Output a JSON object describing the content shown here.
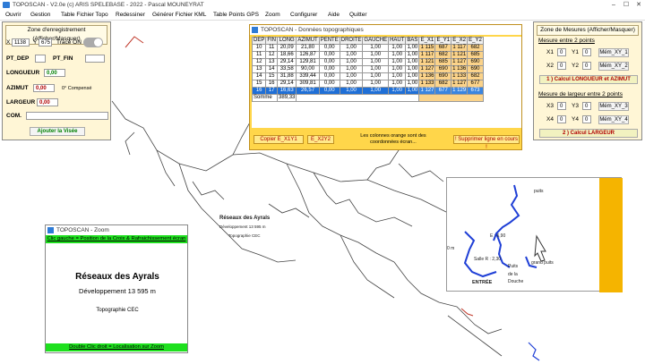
{
  "window": {
    "title": "TOPOSCAN - V2.0e (c) ARIS SPELEBASE - 2022 - Pascal MOUNEYRAT",
    "controls": [
      "–",
      "☐",
      "✕"
    ]
  },
  "menu": [
    "Ouvrir",
    "Gestion",
    "Table Fichier Topo",
    "Redessiner",
    "Générer Fichier KML",
    "Table Points GPS",
    "Zoom",
    "Configurer",
    "Aide",
    "Quitter"
  ],
  "left_panel": {
    "header": "Zone d'enregistrement (Afficher/Masquer)",
    "x_label": "X",
    "x_value": "1138",
    "y_label": "Y",
    "y_value": "675",
    "trace_label": "Tracé ON",
    "pt_dep": "PT_DEP",
    "pt_fin": "PT_FIN",
    "longueur_label": "LONGUEUR",
    "longueur_value": "0,00",
    "azimut_label": "AZIMUT",
    "azimut_value": "0,00",
    "azimut_note": "0° Compensé",
    "largeur_label": "LARGEUR",
    "largeur_value": "0,00",
    "com_label": "COM.",
    "add_button": "Ajouter la Visée"
  },
  "topo_window": {
    "title": "TOPOSCAN - Données topographiques",
    "columns": [
      "DEP",
      "FIN",
      "LONG",
      "AZIMUT",
      "PENTE",
      "DROITE",
      "GAUCHE",
      "HAUT",
      "BAS",
      "E_X1",
      "E_Y1",
      "E_X2",
      "E_Y2"
    ],
    "rows": [
      [
        "10",
        "11",
        "20,09",
        "21,80",
        "0,00",
        "1,00",
        "1,00",
        "1,00",
        "1,00",
        "1 115",
        "687",
        "1 117",
        "682"
      ],
      [
        "11",
        "12",
        "18,66",
        "126,87",
        "0,00",
        "1,00",
        "1,00",
        "1,00",
        "1,00",
        "1 117",
        "682",
        "1 121",
        "685"
      ],
      [
        "12",
        "13",
        "29,14",
        "129,81",
        "0,00",
        "1,00",
        "1,00",
        "1,00",
        "1,00",
        "1 121",
        "685",
        "1 127",
        "690"
      ],
      [
        "13",
        "14",
        "33,58",
        "90,00",
        "0,00",
        "1,00",
        "1,00",
        "1,00",
        "1,00",
        "1 127",
        "690",
        "1 136",
        "690"
      ],
      [
        "14",
        "15",
        "31,88",
        "339,44",
        "0,00",
        "1,00",
        "1,00",
        "1,00",
        "1,00",
        "1 136",
        "690",
        "1 133",
        "682"
      ],
      [
        "15",
        "16",
        "29,14",
        "309,81",
        "0,00",
        "1,00",
        "1,00",
        "1,00",
        "1,00",
        "1 133",
        "682",
        "1 127",
        "677"
      ],
      [
        "16",
        "17",
        "16,63",
        "26,57",
        "0,00",
        "1,00",
        "1,00",
        "1,00",
        "1,00",
        "1 127",
        "677",
        "1 129",
        "673"
      ]
    ],
    "selected_row": 6,
    "somme_label": "Somme",
    "somme_value": "389,33",
    "copy_button": "Copier E_X1Y1",
    "ex2_button": "E_X2Y2",
    "note": "Les colonnes orange sont des coordonnées écran...",
    "delete_button": "! Supprimer ligne en cours !"
  },
  "zoom_window": {
    "title": "TOPOSCAN - Zoom",
    "top_hint": "Clic gauche = Position de la Croix & Rafraichissement écran",
    "preview_title": "Réseaux des Ayrals",
    "preview_sub": "Développement 13 595 m",
    "preview_credit": "Topographie CEC",
    "bottom_hint": "Double Clic droit = Localisation sur Zoom"
  },
  "right_panel": {
    "header": "Zone de Mesures (Afficher/Masquer)",
    "section1": "Mesure entre 2 points",
    "row1": {
      "x": "X1",
      "xv": "0",
      "y": "Y1",
      "yv": "0",
      "btn": "Mém_XY_1"
    },
    "row2": {
      "x": "X2",
      "xv": "0",
      "y": "Y2",
      "yv": "0",
      "btn": "Mém_XY_2"
    },
    "calc1": "1 ) Calcul LONGUEUR et AZIMUT",
    "section2": "Mesure de largeur entre 2 points",
    "row3": {
      "x": "X3",
      "xv": "0",
      "y": "Y3",
      "yv": "0",
      "btn": "Mém_XY_3"
    },
    "row4": {
      "x": "X4",
      "xv": "0",
      "y": "Y4",
      "yv": "0",
      "btn": "Mém_XY_4"
    },
    "calc2": "2 ) Calcul LARGEUR"
  },
  "map_labels": {
    "title": "Réseaux des Ayrals",
    "sub": "Développement 13 595 m",
    "credit": "Topographie CEC",
    "inset_entree": "ENTRÉE",
    "inset_puits": "puits",
    "inset_e": "E : 6,90",
    "inset_salle": "Salle R : 2,30",
    "inset_grand": "grand puits",
    "inset_de_la": "de la",
    "inset_douche": "Douche",
    "inset_puits2": "Puits",
    "inset_zero": "0 m"
  },
  "colors": {
    "accent_blue": "#1f6fd6",
    "orange_cols": "#fbd38a",
    "panel_bg": "#fff6d6",
    "green_bar": "#1ee01e",
    "red_button": "#b00000"
  }
}
